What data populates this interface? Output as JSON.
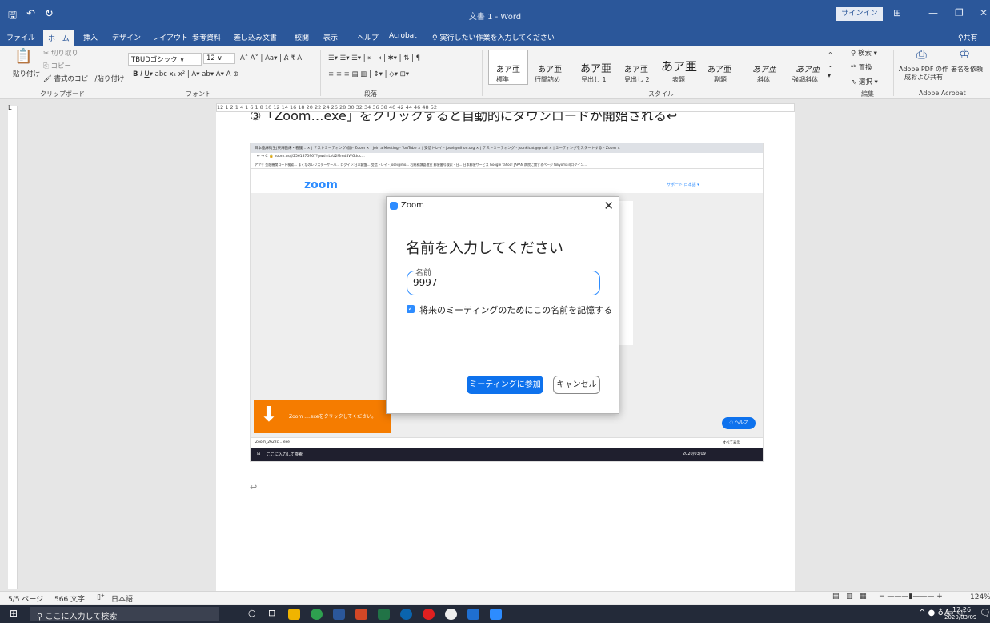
{
  "titlebar": {
    "doc_title": "文書 1 - Word",
    "signin": "サインイン",
    "save_icon": "save-icon",
    "undo_icon": "undo-icon",
    "redo_icon": "redo-icon"
  },
  "tabs": [
    "ファイル",
    "ホーム",
    "挿入",
    "デザイン",
    "レイアウト",
    "参考資料",
    "差し込み文書",
    "校閲",
    "表示",
    "ヘルプ",
    "Acrobat",
    "実行したい作業を入力してください"
  ],
  "share": "共有",
  "clipboard": {
    "paste": "貼り付け",
    "cut": "切り取り",
    "copy": "コピー",
    "format_painter": "書式のコピー/貼り付け",
    "group": "クリップボード"
  },
  "font": {
    "name": "TBUDゴシック",
    "size": "12",
    "group": "フォント"
  },
  "paragraph": {
    "group": "段落"
  },
  "styles": {
    "items": [
      {
        "sample": "あア亜",
        "label": "標準"
      },
      {
        "sample": "あア亜",
        "label": "行間詰め"
      },
      {
        "sample": "あア亜",
        "label": "見出し 1"
      },
      {
        "sample": "あア亜",
        "label": "見出し 2"
      },
      {
        "sample": "あア亜",
        "label": "表題"
      },
      {
        "sample": "あア亜",
        "label": "副題"
      },
      {
        "sample": "あア亜",
        "label": "斜体"
      },
      {
        "sample": "あア亜",
        "label": "強調斜体"
      }
    ],
    "group": "スタイル"
  },
  "editing": {
    "find": "検索",
    "replace": "置換",
    "select": "選択",
    "group": "編集"
  },
  "acrobat": {
    "create_pdf": "Adobe PDF の作成および共有",
    "sign": "署名を依頼",
    "group": "Adobe Acrobat"
  },
  "ruler_text": "12 1 2 1 4 1 6 1 8 10 12 14 16 18 20 22 24 26 28 30 32 34 36 38 40 42 44 46 48 52",
  "page": {
    "heading": "③「Zoom…exe」をクリックすると自動的にダウンロードが開始される↩",
    "return_mark": "↩"
  },
  "browser": {
    "tabs": "日本臨床衛生|東海臨床・看護... × | テストミーティング(仮)- Zoom × | Join a Meeting - YouTube × | 受信トレイ - josei@nihon.org × | テストミーティング - jsonkicat@gmail × | ミーティングをスタートする - Zoom ×",
    "url": "zoom.us/j/2561875967?pwd=LzU2Mmd5WGduc...",
    "bookmarks": "アプリ  金融機関コード検索...  まくなのレジスターサーバ...  ログイン:日本鍵盤...  受信トレイ - josei@mo...  右総務課管理室  郵便番号検索 - 日...  日本郵便サービス  Google  Yahoo! JAPAN  病院に関するページ  tokyomail(ログイン..."
  },
  "zoom_page": {
    "logo": "zoom",
    "links": "サポート  日本語 ▾",
    "banner": "Zoom ....exeをクリックしてください。",
    "help": "ヘルプ",
    "download_file": "Zoom_2622c....exe",
    "show_all": "すべて表示"
  },
  "dialog": {
    "title": "Zoom",
    "heading": "名前を入力してください",
    "field_label": "名前",
    "field_value": "9997",
    "remember": "将来のミーティングのためにこの名前を記憶する",
    "join": "ミーティングに参加",
    "cancel": "キャンセル"
  },
  "statusbar": {
    "page": "5/5 ページ",
    "words": "566 文字",
    "lang": "日本語",
    "zoom": "124%"
  },
  "taskbar": {
    "search": "ここに入力して検索",
    "time": "12:26",
    "date": "2020/03/09",
    "ime": "A"
  }
}
